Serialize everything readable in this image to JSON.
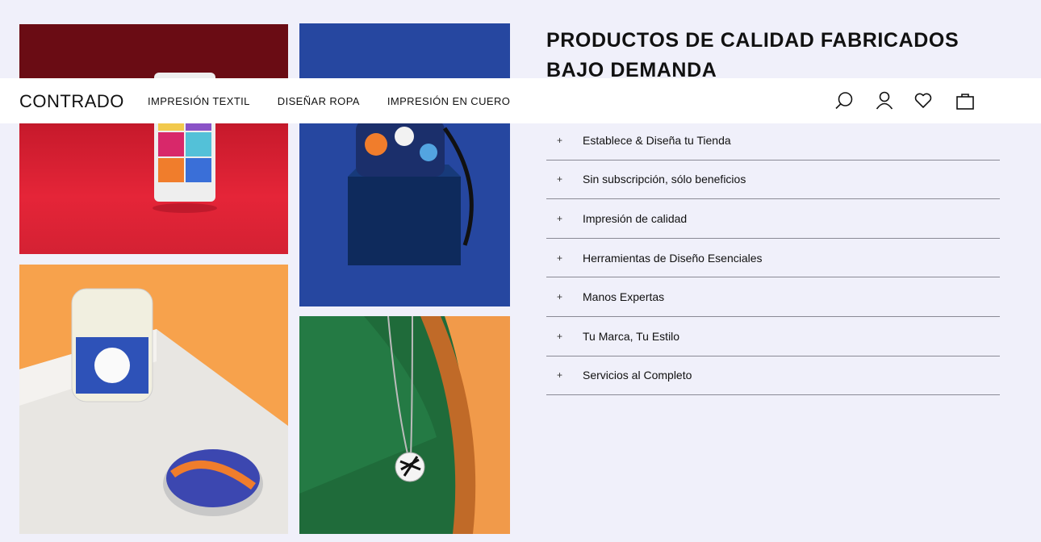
{
  "header": {
    "logo": "CONTRADO",
    "nav": [
      "IMPRESIÓN TEXTIL",
      "DISEÑAR ROPA",
      "IMPRESIÓN EN CUERO"
    ],
    "icons": [
      "search-icon",
      "user-icon",
      "heart-icon",
      "shopping-bag-icon"
    ]
  },
  "main": {
    "title": "PRODUCTOS DE CALIDAD FABRICADOS BAJO DEMANDA",
    "accordion": [
      {
        "symbol": "+",
        "label": "Establece & Diseña tu Tienda"
      },
      {
        "symbol": "+",
        "label": "Sin subscripción, sólo beneficios"
      },
      {
        "symbol": "+",
        "label": "Impresión de calidad"
      },
      {
        "symbol": "+",
        "label": "Herramientas de Diseño Esenciales"
      },
      {
        "symbol": "+",
        "label": "Manos Expertas"
      },
      {
        "symbol": "+",
        "label": "Tu Marca, Tu Estilo"
      },
      {
        "symbol": "+",
        "label": "Servicios al Completo"
      }
    ]
  },
  "colors": {
    "page_bg": "#f0f0fa",
    "header_bg": "#ffffff",
    "divider": "#8a8a95",
    "tile_red": "#e52538",
    "tile_blue": "#2647a0",
    "tile_orange": "#f7a24c",
    "tile_green": "#1f6b3a"
  }
}
